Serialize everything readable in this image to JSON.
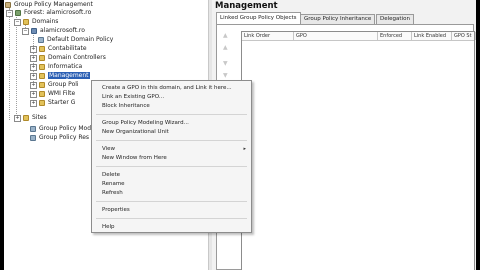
{
  "tree": {
    "items": [
      {
        "label": "Group Policy Management",
        "icon": "gpm-icon",
        "expander": ""
      },
      {
        "label": "Forest: alamicrosoft.ro",
        "icon": "forest-icon",
        "expander": "−"
      },
      {
        "label": "Domains",
        "icon": "folder-icon",
        "expander": "−"
      },
      {
        "label": "alamicrosoft.ro",
        "icon": "domain-icon",
        "expander": "−"
      },
      {
        "label": "Default Domain Policy",
        "icon": "gpo-icon",
        "expander": ""
      },
      {
        "label": "Contabilitate",
        "icon": "folder-icon",
        "expander": "+"
      },
      {
        "label": "Domain Controllers",
        "icon": "folder-icon",
        "expander": "+"
      },
      {
        "label": "Informatica",
        "icon": "folder-icon",
        "expander": "+"
      },
      {
        "label": "Management",
        "icon": "folder-icon",
        "expander": "+"
      },
      {
        "label": "Group Poli",
        "icon": "folder-icon",
        "expander": "+"
      },
      {
        "label": "WMI Filte",
        "icon": "folder-icon",
        "expander": "+"
      },
      {
        "label": "Starter G",
        "icon": "folder-icon",
        "expander": "+"
      },
      {
        "label": "Sites",
        "icon": "folder-icon",
        "expander": "+"
      },
      {
        "label": "Group Policy Mod",
        "icon": "gpo-icon",
        "expander": ""
      },
      {
        "label": "Group Policy Res",
        "icon": "gpo-icon",
        "expander": ""
      }
    ]
  },
  "right": {
    "title": "Management",
    "tabs": [
      "Linked Group Policy Objects",
      "Group Policy Inheritance",
      "Delegation"
    ],
    "columns": [
      "Link Order",
      "GPO",
      "Enforced",
      "Link Enabled",
      "GPO St"
    ]
  },
  "context_menu": {
    "items": [
      "Create a GPO in this domain, and Link it here...",
      "Link an Existing GPO...",
      "Block Inheritance",
      "Group Policy Modeling Wizard...",
      "New Organizational Unit",
      "View",
      "New Window from Here",
      "Delete",
      "Rename",
      "Refresh",
      "Properties",
      "Help"
    ],
    "submenu_arrow": "▸"
  },
  "colors": {
    "selection": "#2b5fb4",
    "pane_bg": "#f2f2f2"
  }
}
